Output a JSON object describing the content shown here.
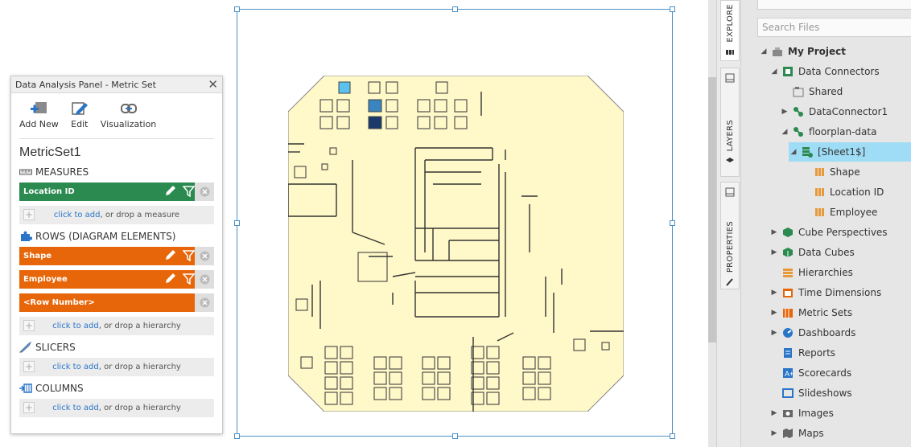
{
  "panel": {
    "title": "Data Analysis Panel - Metric Set",
    "close_label": "✕",
    "tools": [
      {
        "label": "Add New",
        "icon": "add-new-icon"
      },
      {
        "label": "Edit",
        "icon": "edit-icon"
      },
      {
        "label": "Visualization",
        "icon": "visualization-icon"
      }
    ],
    "metric_set_name": "MetricSet1",
    "measures_label": "MEASURES",
    "measures": [
      {
        "label": "Location ID",
        "color": "#2b8a4f"
      }
    ],
    "measure_drop": {
      "link": "click to add",
      "rest": ", or drop a measure"
    },
    "rows_label": "ROWS (DIAGRAM ELEMENTS)",
    "rows": [
      {
        "label": "Shape",
        "color": "#e8660a",
        "tools": true
      },
      {
        "label": "Employee",
        "color": "#e8660a",
        "tools": true
      },
      {
        "label": "<Row Number>",
        "color": "#e8660a",
        "tools": false
      }
    ],
    "rows_drop": {
      "link": "click to add",
      "rest": ", or drop a hierarchy"
    },
    "slicers_label": "SLICERS",
    "slicers_drop": {
      "link": "click to add",
      "rest": ", or drop a hierarchy"
    },
    "columns_label": "COLUMNS",
    "columns_drop": {
      "link": "click to add",
      "rest": ", or drop a hierarchy"
    }
  },
  "tabs": {
    "explore": "EXPLORE",
    "layers": "LAYERS",
    "properties": "PROPERTIES"
  },
  "explorer": {
    "search_placeholder": "Search Files",
    "tree": [
      {
        "label": "My Project",
        "icon": "project-icon",
        "arrow": "down",
        "indent": 0,
        "bold": true
      },
      {
        "label": "Data Connectors",
        "icon": "data-connectors-icon",
        "arrow": "down",
        "indent": 1
      },
      {
        "label": "Shared",
        "icon": "shared-folder-icon",
        "arrow": "",
        "indent": 2
      },
      {
        "label": "DataConnector1",
        "icon": "data-connector-icon",
        "arrow": "right",
        "indent": 2
      },
      {
        "label": "floorplan-data",
        "icon": "data-connector-icon",
        "arrow": "down",
        "indent": 2
      },
      {
        "label": "[Sheet1$]",
        "icon": "sheet-icon",
        "arrow": "down",
        "indent": 3,
        "selected": true
      },
      {
        "label": "Shape",
        "icon": "column-icon",
        "arrow": "",
        "indent": 4
      },
      {
        "label": "Location ID",
        "icon": "column-icon",
        "arrow": "",
        "indent": 4
      },
      {
        "label": "Employee",
        "icon": "column-icon",
        "arrow": "",
        "indent": 4
      },
      {
        "label": "Cube Perspectives",
        "icon": "cube-perspectives-icon",
        "arrow": "right",
        "indent": 1
      },
      {
        "label": "Data Cubes",
        "icon": "data-cubes-icon",
        "arrow": "right",
        "indent": 1
      },
      {
        "label": "Hierarchies",
        "icon": "hierarchies-icon",
        "arrow": "",
        "indent": 1
      },
      {
        "label": "Time Dimensions",
        "icon": "time-dimensions-icon",
        "arrow": "right",
        "indent": 1
      },
      {
        "label": "Metric Sets",
        "icon": "metric-sets-icon",
        "arrow": "right",
        "indent": 1
      },
      {
        "label": "Dashboards",
        "icon": "dashboards-icon",
        "arrow": "right",
        "indent": 1
      },
      {
        "label": "Reports",
        "icon": "reports-icon",
        "arrow": "",
        "indent": 1
      },
      {
        "label": "Scorecards",
        "icon": "scorecards-icon",
        "arrow": "",
        "indent": 1
      },
      {
        "label": "Slideshows",
        "icon": "slideshows-icon",
        "arrow": "",
        "indent": 1
      },
      {
        "label": "Images",
        "icon": "images-icon",
        "arrow": "right",
        "indent": 1
      },
      {
        "label": "Maps",
        "icon": "maps-icon",
        "arrow": "right",
        "indent": 1
      }
    ]
  },
  "floorplan": {
    "highlight_colors": [
      "#5bc2f0",
      "#3a85c0",
      "#1a3a6b"
    ],
    "floor_color": "#fff8c8"
  }
}
